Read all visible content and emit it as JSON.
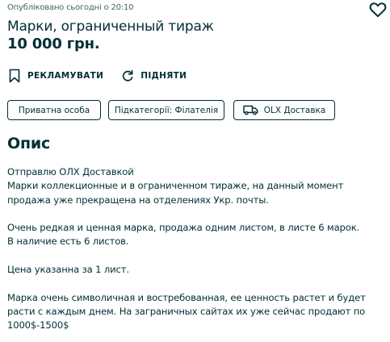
{
  "listing": {
    "posted": "Опубліковано сьогодні о 20:10",
    "title": "Марки, ограниченный тираж",
    "price": "10 000 грн."
  },
  "actions": {
    "promote_label": "РЕКЛАМУВАТИ",
    "raise_label": "ПІДНЯТИ"
  },
  "tags": [
    {
      "label": "Приватна особа"
    },
    {
      "label": "Підкатегорії: Філателія"
    },
    {
      "label": "OLX Доставка",
      "icon": "truck-icon"
    }
  ],
  "description": {
    "heading": "Опис",
    "lines": [
      "Отправлю ОЛХ Доставкой",
      "Марки коллекционные и в ограниченном тираже, на данный момент",
      "продажа уже прекращена на отделениях Укр. почты.",
      "",
      "Очень редкая и ценная марка, продажа одним листом, в листе 6 марок.",
      "В наличие есть 6 листов.",
      "",
      "Цена указанна за 1 лист.",
      "",
      "Марка очень символичная и востребованная, ее ценность растет и будет",
      "расти с каждым днем. На заграничных сайтах их уже сейчас продают по",
      "1000$-1500$"
    ]
  },
  "colors": {
    "text": "#002f34",
    "muted": "#406367",
    "background": "#ffffff"
  }
}
